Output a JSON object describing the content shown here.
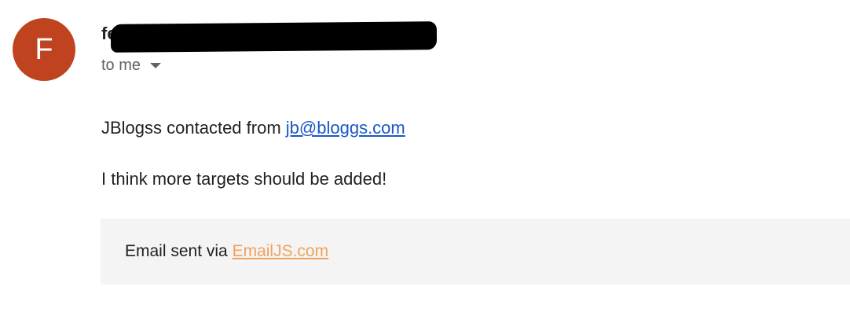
{
  "sender": {
    "avatar_letter": "F",
    "name_visible": "fe",
    "to_label": "to me"
  },
  "message": {
    "line1_prefix": "JBlogss contacted from ",
    "email_link": "jb@bloggs.com",
    "line2": "I think more targets should be added!"
  },
  "footer": {
    "prefix": "Email sent via ",
    "link": "EmailJS.com"
  },
  "colors": {
    "avatar": "#c0431f",
    "link_blue": "#1a57c6",
    "link_orange": "#f0a35e",
    "footer_bg": "#f4f4f4"
  }
}
